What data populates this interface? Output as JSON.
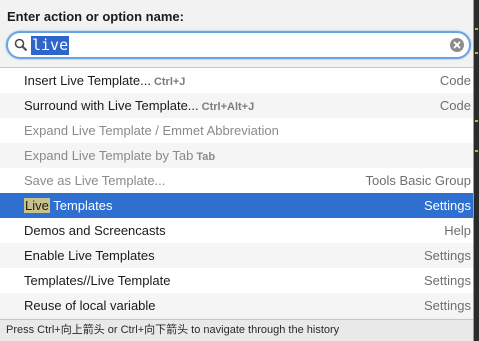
{
  "dialog": {
    "prompt": "Enter action or option name:",
    "search": {
      "value": "live",
      "placeholder": ""
    }
  },
  "results": [
    {
      "name": "Insert Live Template...",
      "shortcut": "Ctrl+J",
      "group": "Code",
      "state": "normal"
    },
    {
      "name": "Surround with Live Template...",
      "shortcut": "Ctrl+Alt+J",
      "group": "Code",
      "state": "normal"
    },
    {
      "name": "Expand Live Template / Emmet Abbreviation",
      "shortcut": "",
      "group": "",
      "state": "disabled"
    },
    {
      "name": "Expand Live Template by Tab",
      "shortcut": "Tab",
      "group": "",
      "state": "disabled"
    },
    {
      "name": "Save as Live Template...",
      "shortcut": "",
      "group": "Tools Basic Group",
      "state": "disabled"
    },
    {
      "name_match": "Live",
      "name_rest": " Templates",
      "name": "Live Templates",
      "shortcut": "",
      "group": "Settings",
      "state": "selected"
    },
    {
      "name": "Demos and Screencasts",
      "shortcut": "",
      "group": "Help",
      "state": "normal"
    },
    {
      "name": "Enable Live Templates",
      "shortcut": "",
      "group": "Settings",
      "state": "normal"
    },
    {
      "name": "Templates//Live Template",
      "shortcut": "",
      "group": "Settings",
      "state": "normal"
    },
    {
      "name": "Reuse of local variable",
      "shortcut": "",
      "group": "Settings",
      "state": "normal"
    }
  ],
  "footer": {
    "hint": "Press Ctrl+向上箭头 or Ctrl+向下箭头 to navigate through the history"
  },
  "icons": {
    "search": "search-icon",
    "clear": "clear-icon"
  },
  "colors": {
    "selection": "#2e6fcf",
    "search_border": "#6aa3e0",
    "match_highlight": "#c9c28a"
  }
}
